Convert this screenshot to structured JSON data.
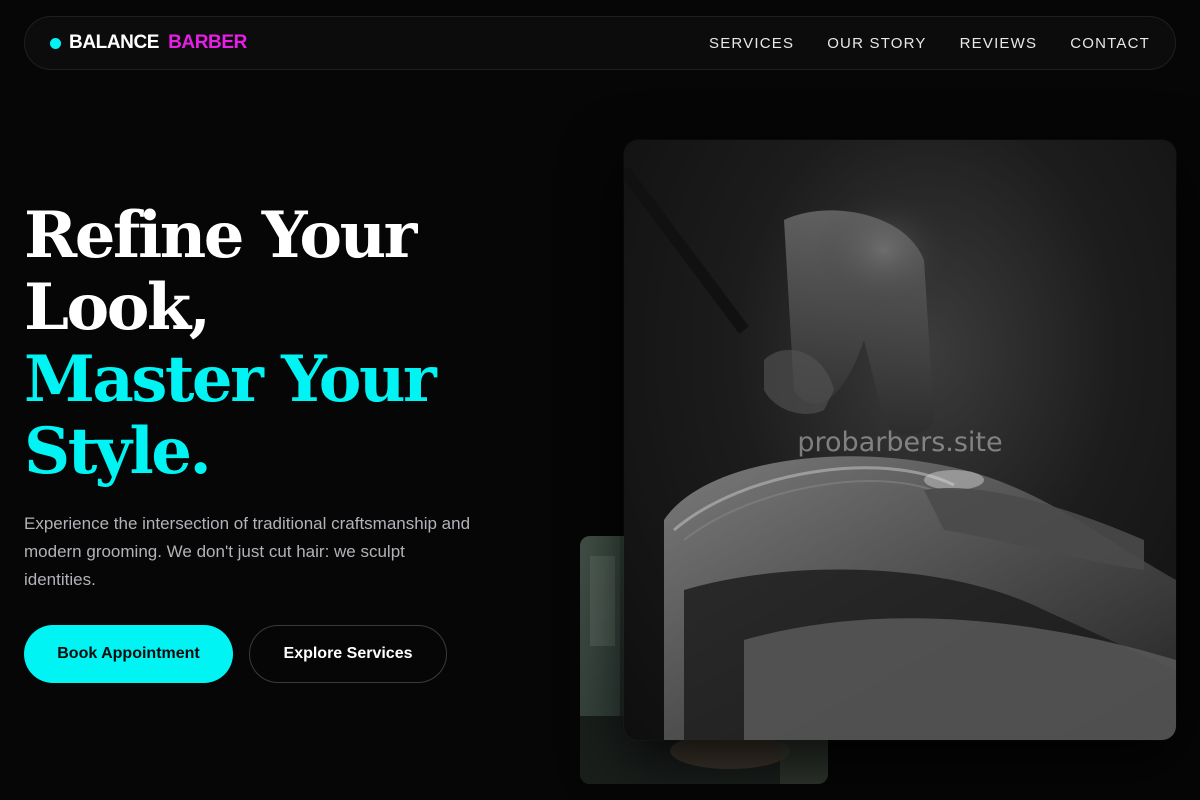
{
  "brand": {
    "name": "BALANCE",
    "accent": "BARBER",
    "dot_color": "#00f4f4",
    "accent_color": "#e61ee8"
  },
  "nav": {
    "links": [
      "SERVICES",
      "OUR STORY",
      "REVIEWS",
      "CONTACT"
    ]
  },
  "hero": {
    "title_lines": [
      "Refine Your",
      "Look,"
    ],
    "title_accent_lines": [
      "Master Your",
      "Style."
    ],
    "description": "Experience the intersection of traditional craftsmanship and modern grooming. We don't just cut hair: we sculpt identities.",
    "primary_button": "Book Appointment",
    "secondary_button": "Explore Services"
  },
  "images": {
    "main_watermark": "probarbers.site"
  },
  "colors": {
    "background": "#060606",
    "accent": "#00f4f4",
    "brand_magenta": "#e61ee8"
  }
}
